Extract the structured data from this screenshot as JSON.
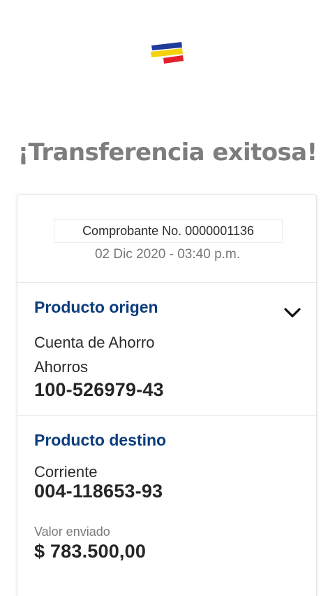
{
  "header": {
    "logo_name": "bank-flag-logo",
    "logo_colors": [
      "#1f3c9b",
      "#f5d20a",
      "#e3202c"
    ]
  },
  "title": "¡Transferencia exitosa!",
  "receipt": {
    "number_label": "Comprobante No. 0000001136",
    "datetime": "02 Dic 2020 - 03:40 p.m."
  },
  "origin": {
    "heading": "Producto origen",
    "account_name": "Cuenta de Ahorro",
    "account_type": "Ahorros",
    "account_number": "100-526979-43",
    "toggle_icon": "chevron-down-icon"
  },
  "destination": {
    "heading": "Producto destino",
    "account_type": "Corriente",
    "account_number": "004-118653-93"
  },
  "amount": {
    "label": "Valor enviado",
    "value": "$ 783.500,00"
  },
  "colors": {
    "heading_blue": "#0c3d7d",
    "title_gray": "#7d7d7d"
  }
}
